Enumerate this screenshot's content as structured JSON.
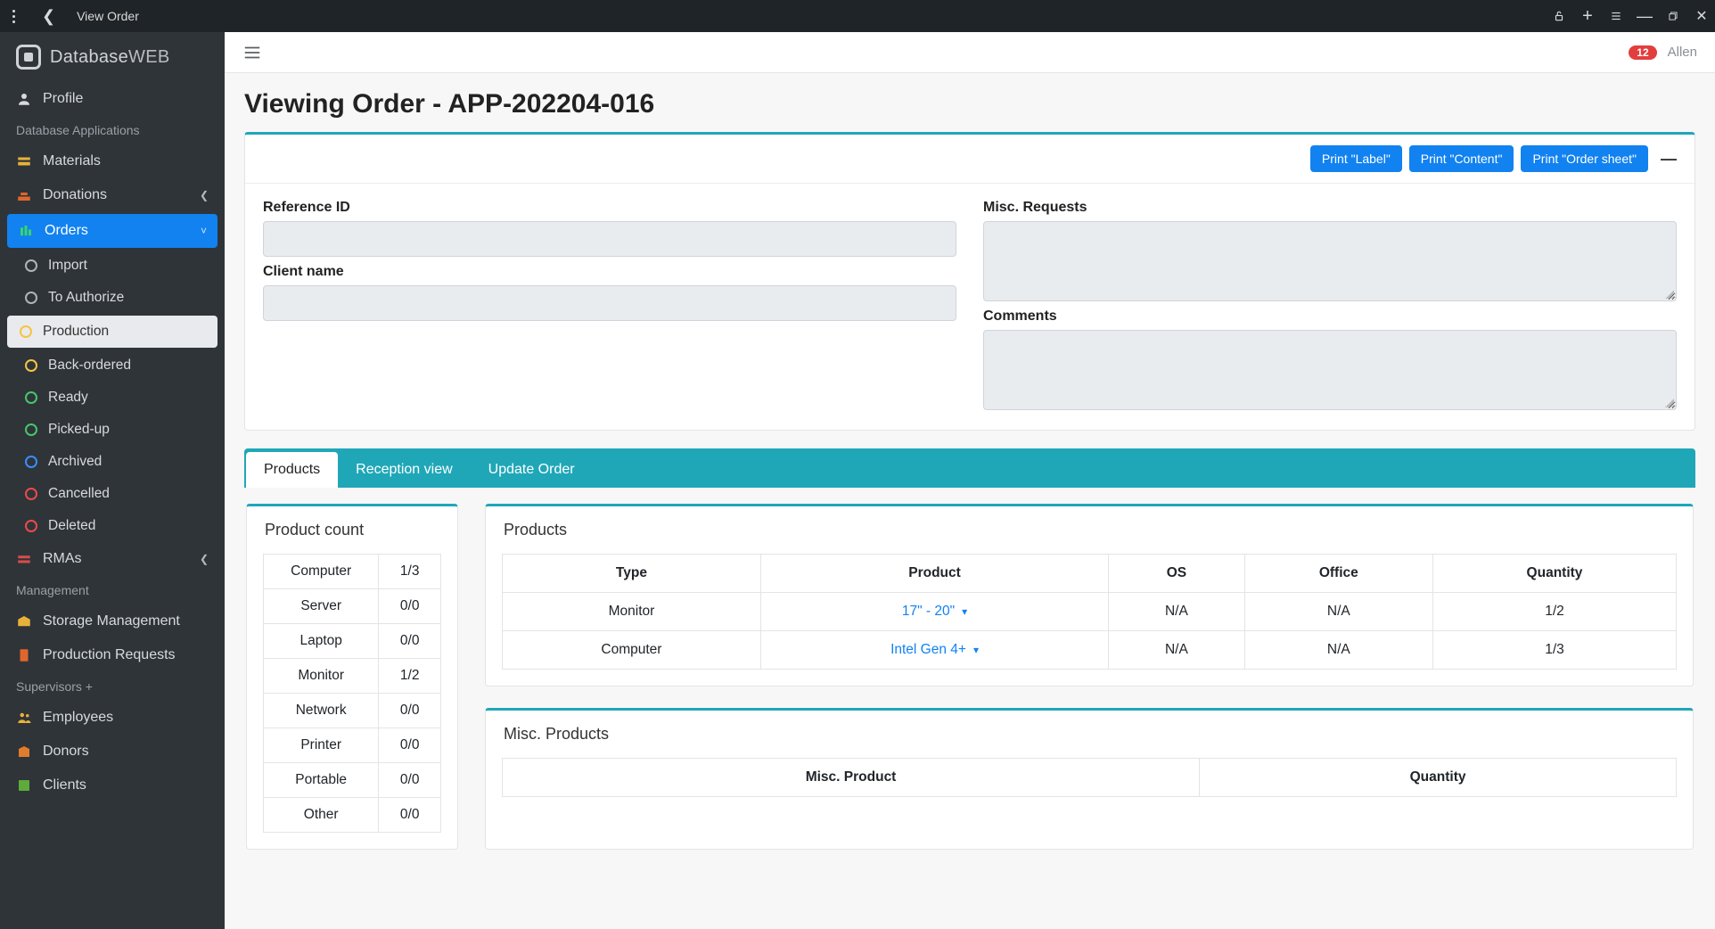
{
  "window": {
    "title": "View Order"
  },
  "brand": {
    "name": "Database",
    "suffix": "WEB"
  },
  "topbar": {
    "badge": "12",
    "user": "Allen"
  },
  "sidebar": {
    "profile_label": "Profile",
    "section_apps": "Database Applications",
    "section_mgmt": "Management",
    "section_sup": "Supervisors +",
    "items": {
      "materials": "Materials",
      "donations": "Donations",
      "orders": "Orders",
      "rmas": "RMAs",
      "storage": "Storage Management",
      "prodreq": "Production Requests",
      "employees": "Employees",
      "donors": "Donors",
      "clients": "Clients"
    },
    "orders_sub": {
      "import": "Import",
      "to_authorize": "To Authorize",
      "production": "Production",
      "back_ordered": "Back-ordered",
      "ready": "Ready",
      "picked_up": "Picked-up",
      "archived": "Archived",
      "cancelled": "Cancelled",
      "deleted": "Deleted"
    }
  },
  "page": {
    "title": "Viewing Order - APP-202204-016",
    "buttons": {
      "print_label": "Print \"Label\"",
      "print_content": "Print \"Content\"",
      "print_sheet": "Print \"Order sheet\""
    },
    "form": {
      "reference_label": "Reference ID",
      "client_label": "Client name",
      "misc_label": "Misc. Requests",
      "comments_label": "Comments"
    },
    "tabs": {
      "products": "Products",
      "reception": "Reception view",
      "update": "Update Order"
    },
    "count_panel": {
      "title": "Product count"
    },
    "counts": [
      {
        "label": "Computer",
        "value": "1/3"
      },
      {
        "label": "Server",
        "value": "0/0"
      },
      {
        "label": "Laptop",
        "value": "0/0"
      },
      {
        "label": "Monitor",
        "value": "1/2"
      },
      {
        "label": "Network",
        "value": "0/0"
      },
      {
        "label": "Printer",
        "value": "0/0"
      },
      {
        "label": "Portable",
        "value": "0/0"
      },
      {
        "label": "Other",
        "value": "0/0"
      }
    ],
    "products_panel": {
      "title": "Products"
    },
    "products_headers": {
      "type": "Type",
      "product": "Product",
      "os": "OS",
      "office": "Office",
      "qty": "Quantity"
    },
    "products": [
      {
        "type": "Monitor",
        "product": "17\" - 20\"",
        "os": "N/A",
        "office": "N/A",
        "qty": "1/2"
      },
      {
        "type": "Computer",
        "product": "Intel Gen 4+",
        "os": "N/A",
        "office": "N/A",
        "qty": "1/3"
      }
    ],
    "misc_panel": {
      "title": "Misc. Products"
    },
    "misc_headers": {
      "product": "Misc. Product",
      "qty": "Quantity"
    }
  }
}
